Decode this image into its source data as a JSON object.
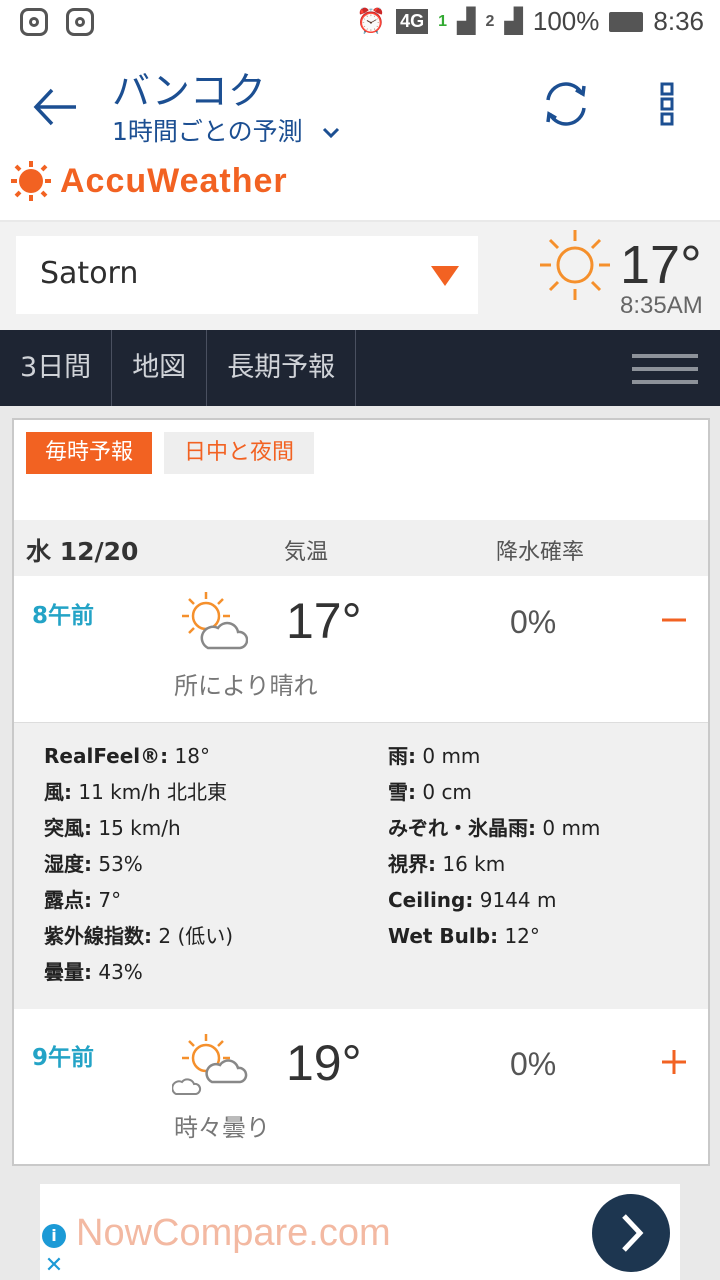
{
  "status_bar": {
    "network": "4G",
    "sim1": "1",
    "sim2": "2",
    "battery": "100%",
    "time": "8:36"
  },
  "app_bar": {
    "city": "バンコク",
    "subtitle": "1時間ごとの予測"
  },
  "logo": {
    "text": "AccuWeather",
    "color": "#f26222"
  },
  "location": {
    "name": "Satorn"
  },
  "current": {
    "temp": "17°",
    "time": "8:35AM"
  },
  "nav": {
    "tabs": [
      "3日間",
      "地図",
      "長期予報"
    ]
  },
  "toggle_buttons": {
    "hourly": "毎時予報",
    "day_night": "日中と夜間"
  },
  "table_header": {
    "date": "水 12/20",
    "temp_col": "気温",
    "precip_col": "降水確率"
  },
  "hours": [
    {
      "time": "8午前",
      "temp": "17°",
      "precip": "0%",
      "desc": "所により晴れ",
      "toggle": "−",
      "icon": "partly-sunny-icon",
      "expanded": true
    },
    {
      "time": "9午前",
      "temp": "19°",
      "precip": "0%",
      "desc": "時々曇り",
      "toggle": "+",
      "icon": "intermittent-clouds-icon",
      "expanded": false
    }
  ],
  "details_left": [
    {
      "label": "RealFeel®:",
      "value": " 18°"
    },
    {
      "label": "風:",
      "value": " 11 km/h 北北東"
    },
    {
      "label": "突風:",
      "value": " 15 km/h"
    },
    {
      "label": "湿度:",
      "value": " 53%"
    },
    {
      "label": "露点:",
      "value": " 7°"
    },
    {
      "label": "紫外線指数:",
      "value": " 2 (低い)"
    },
    {
      "label": "曇量:",
      "value": " 43%"
    }
  ],
  "details_right": [
    {
      "label": "雨:",
      "value": " 0 mm"
    },
    {
      "label": "雪:",
      "value": " 0 cm"
    },
    {
      "label": "みぞれ・氷晶雨:",
      "value": " 0 mm"
    },
    {
      "label": "視界:",
      "value": " 16 km"
    },
    {
      "label": "Ceiling:",
      "value": " 9144 m"
    },
    {
      "label": "Wet Bulb:",
      "value": " 12°"
    }
  ],
  "ad": {
    "text": "NowCompare.com"
  }
}
